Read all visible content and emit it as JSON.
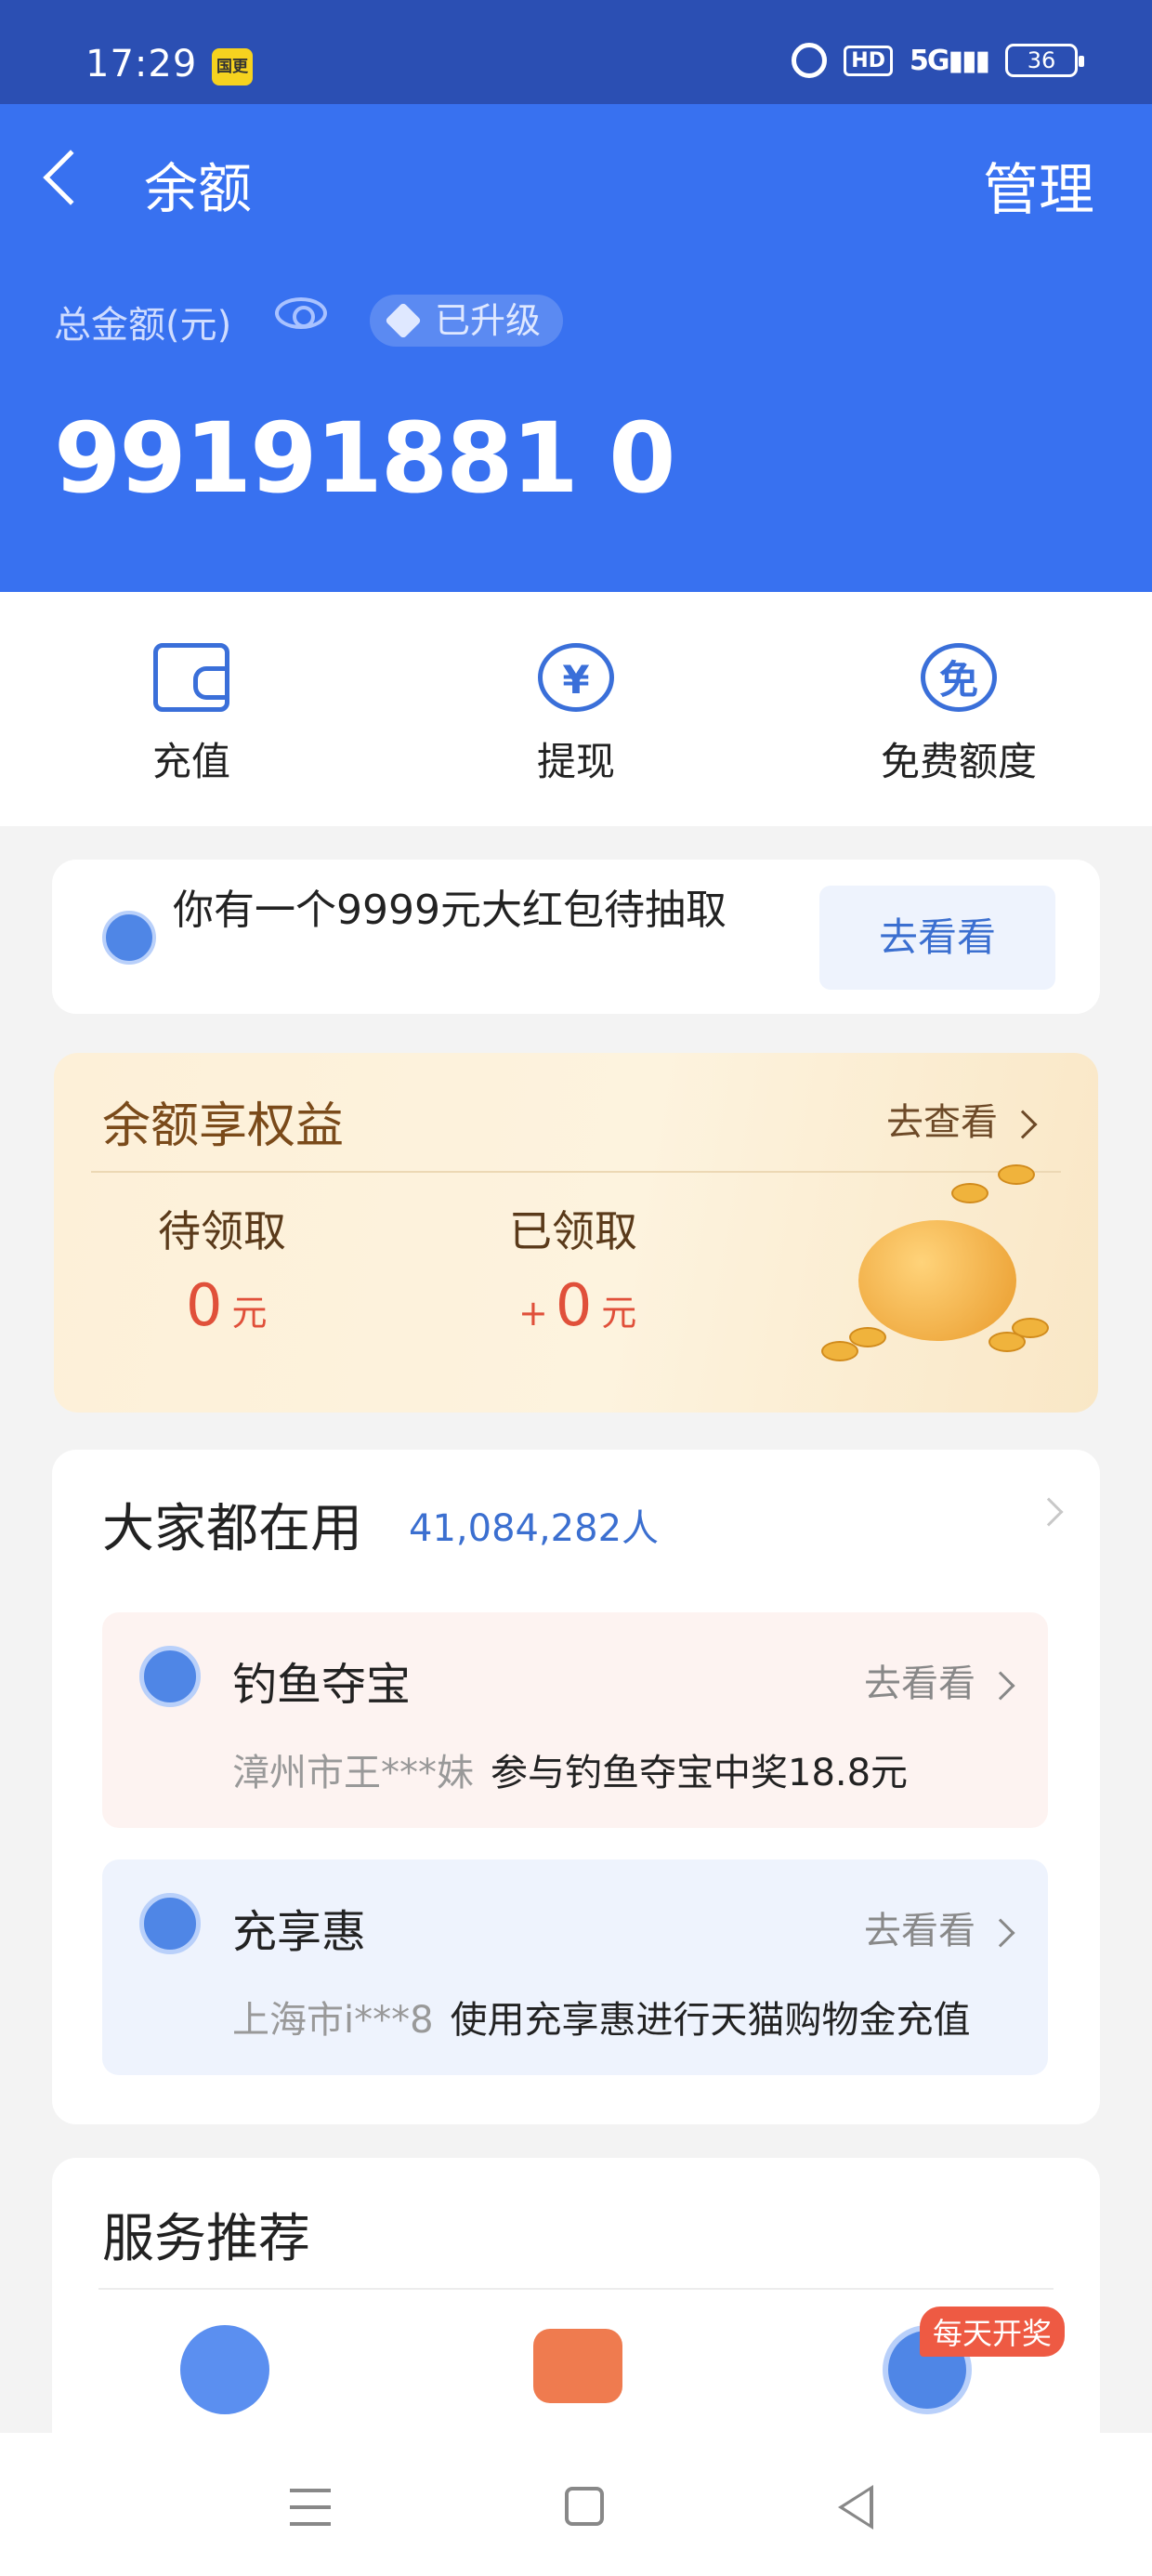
{
  "status_bar": {
    "time": "17:29",
    "badge": "国更",
    "hd": "HD",
    "network": "5G",
    "battery": "36"
  },
  "header": {
    "title": "余额",
    "manage": "管理",
    "total_label": "总金额(元)",
    "upgrade_badge": "已升级",
    "amount": "99191881 0"
  },
  "actions": [
    {
      "label": "充值",
      "icon": "wallet-icon"
    },
    {
      "label": "提现",
      "icon": "yuan-withdraw-icon",
      "glyph": "¥"
    },
    {
      "label": "免费额度",
      "icon": "free-quota-icon",
      "glyph": "免"
    }
  ],
  "red_packet": {
    "text": "你有一个9999元大红包待抽取",
    "button": "去看看"
  },
  "benefits": {
    "title": "余额享权益",
    "link": "去查看",
    "pending_label": "待领取",
    "pending_value": "0",
    "pending_unit": "元",
    "received_label": "已领取",
    "received_prefix": "+",
    "received_value": "0",
    "received_unit": "元"
  },
  "everyone": {
    "title": "大家都在用",
    "count": "41,084,282人",
    "items": [
      {
        "name": "钓鱼夺宝",
        "link": "去看看",
        "who": "漳州市王***妹",
        "desc": "参与钓鱼夺宝中奖18.8元"
      },
      {
        "name": "充享惠",
        "link": "去看看",
        "who": "上海市i***8",
        "desc": "使用充享惠进行天猫购物金充值"
      }
    ]
  },
  "services": {
    "title": "服务推荐",
    "daily_badge": "每天开奖"
  },
  "colors": {
    "header_blue": "#3871f0",
    "status_blue": "#2b4fb3",
    "accent_blue": "#3b6fd0",
    "red": "#e0503a"
  }
}
